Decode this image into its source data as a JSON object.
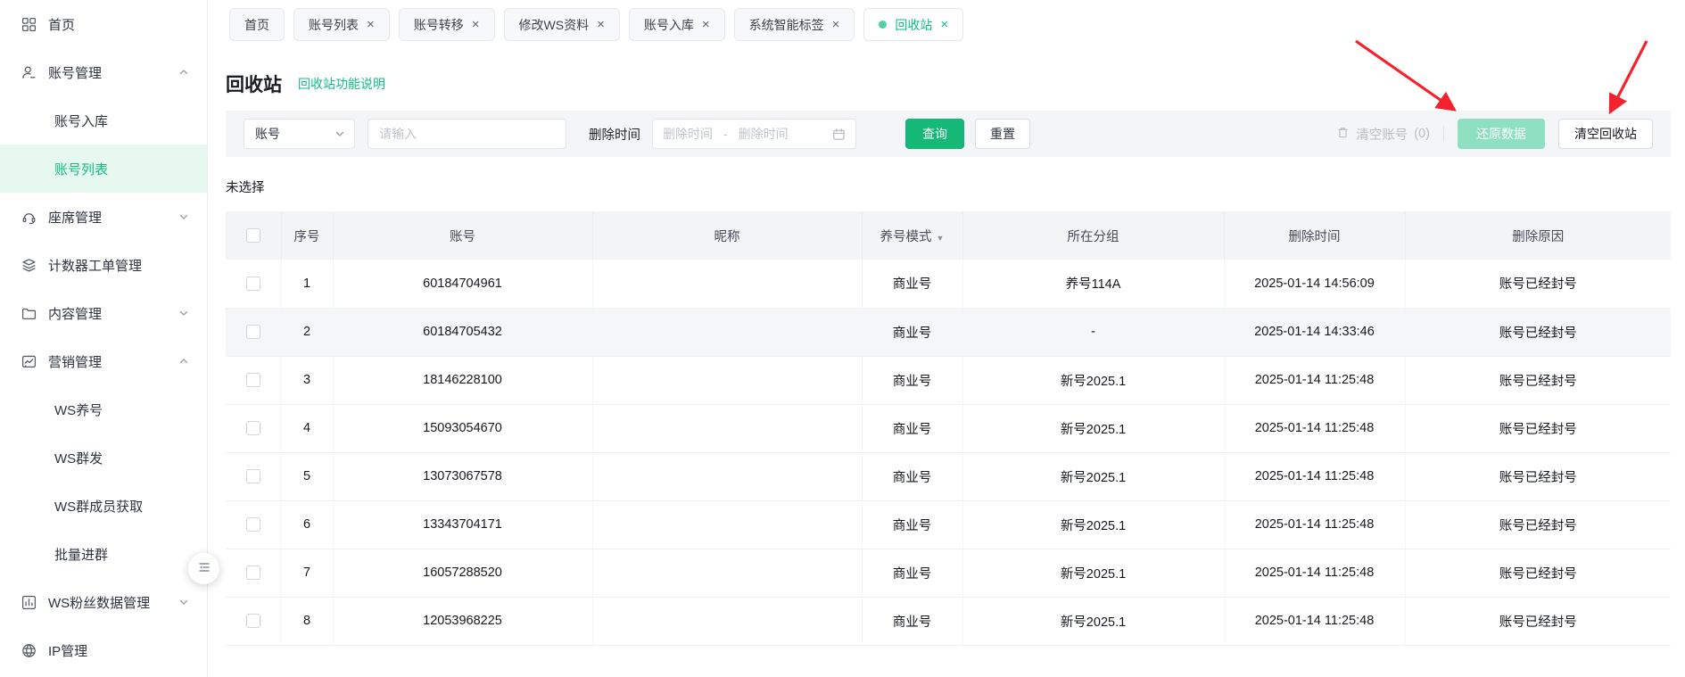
{
  "colors": {
    "accent_green": "#15b877",
    "active_tab_green": "#0fbe86",
    "sidebar_active_bg": "#e7f8f1",
    "mint_button": "#8fdfc1",
    "annotation_arrow_red": "#f5222d"
  },
  "tabs": [
    {
      "label": "首页",
      "closable": false,
      "active": false
    },
    {
      "label": "账号列表",
      "closable": true,
      "active": false
    },
    {
      "label": "账号转移",
      "closable": true,
      "active": false
    },
    {
      "label": "修改WS资料",
      "closable": true,
      "active": false
    },
    {
      "label": "账号入库",
      "closable": true,
      "active": false
    },
    {
      "label": "系统智能标签",
      "closable": true,
      "active": false
    },
    {
      "label": "回收站",
      "closable": true,
      "active": true
    }
  ],
  "sidebar": {
    "items": [
      {
        "id": "home",
        "label": "首页",
        "icon": "grid-icon",
        "level": 0
      },
      {
        "id": "account-management",
        "label": "账号管理",
        "icon": "user-icon",
        "level": 0,
        "chevron": "up"
      },
      {
        "id": "account-import",
        "label": "账号入库",
        "level": 1
      },
      {
        "id": "account-list",
        "label": "账号列表",
        "level": 1,
        "active": true
      },
      {
        "id": "seat-management",
        "label": "座席管理",
        "icon": "headset-icon",
        "level": 0,
        "chevron": "down"
      },
      {
        "id": "counter-ticket-management",
        "label": "计数器工单管理",
        "icon": "layers-icon",
        "level": 0
      },
      {
        "id": "content-management",
        "label": "内容管理",
        "icon": "folder-icon",
        "level": 0,
        "chevron": "down"
      },
      {
        "id": "marketing-management",
        "label": "营销管理",
        "icon": "line-chart-icon",
        "level": 0,
        "chevron": "up"
      },
      {
        "id": "ws-nurture",
        "label": "WS养号",
        "level": 1
      },
      {
        "id": "ws-bulk-send",
        "label": "WS群发",
        "level": 1
      },
      {
        "id": "ws-group-member-fetch",
        "label": "WS群成员获取",
        "level": 1
      },
      {
        "id": "batch-join-group",
        "label": "批量进群",
        "level": 1
      },
      {
        "id": "ws-fans-data-management",
        "label": "WS粉丝数据管理",
        "icon": "bar-chart-icon",
        "level": 0,
        "chevron": "down"
      },
      {
        "id": "ip-management",
        "label": "IP管理",
        "icon": "globe-icon",
        "level": 0
      }
    ]
  },
  "page": {
    "title": "回收站",
    "help_link": "回收站功能说明",
    "selection_status": "未选择"
  },
  "filters": {
    "field_select_value": "账号",
    "keyword_placeholder": "请输入",
    "date_label": "删除时间",
    "date_start_placeholder": "删除时间",
    "date_separator": "-",
    "date_end_placeholder": "删除时间",
    "search_button": "查询",
    "reset_button": "重置"
  },
  "actions": {
    "clear_accounts_label": "清空账号",
    "clear_accounts_count": "(0)",
    "restore_button": "还原数据",
    "empty_trash_button": "清空回收站"
  },
  "table": {
    "columns": [
      {
        "label": "序号"
      },
      {
        "label": "账号"
      },
      {
        "label": "昵称"
      },
      {
        "label": "养号模式",
        "filter": true
      },
      {
        "label": "所在分组"
      },
      {
        "label": "删除时间"
      },
      {
        "label": "删除原因"
      }
    ],
    "highlighted_row": 2,
    "rows": [
      [
        "1",
        "60184704961",
        "",
        "商业号",
        "养号114A",
        "2025-01-14 14:56:09",
        "账号已经封号"
      ],
      [
        "2",
        "60184705432",
        "",
        "商业号",
        "-",
        "2025-01-14 14:33:46",
        "账号已经封号"
      ],
      [
        "3",
        "18146228100",
        "",
        "商业号",
        "新号2025.1",
        "2025-01-14 11:25:48",
        "账号已经封号"
      ],
      [
        "4",
        "15093054670",
        "",
        "商业号",
        "新号2025.1",
        "2025-01-14 11:25:48",
        "账号已经封号"
      ],
      [
        "5",
        "13073067578",
        "",
        "商业号",
        "新号2025.1",
        "2025-01-14 11:25:48",
        "账号已经封号"
      ],
      [
        "6",
        "13343704171",
        "",
        "商业号",
        "新号2025.1",
        "2025-01-14 11:25:48",
        "账号已经封号"
      ],
      [
        "7",
        "16057288520",
        "",
        "商业号",
        "新号2025.1",
        "2025-01-14 11:25:48",
        "账号已经封号"
      ],
      [
        "8",
        "12053968225",
        "",
        "商业号",
        "新号2025.1",
        "2025-01-14 11:25:48",
        "账号已经封号"
      ]
    ]
  }
}
